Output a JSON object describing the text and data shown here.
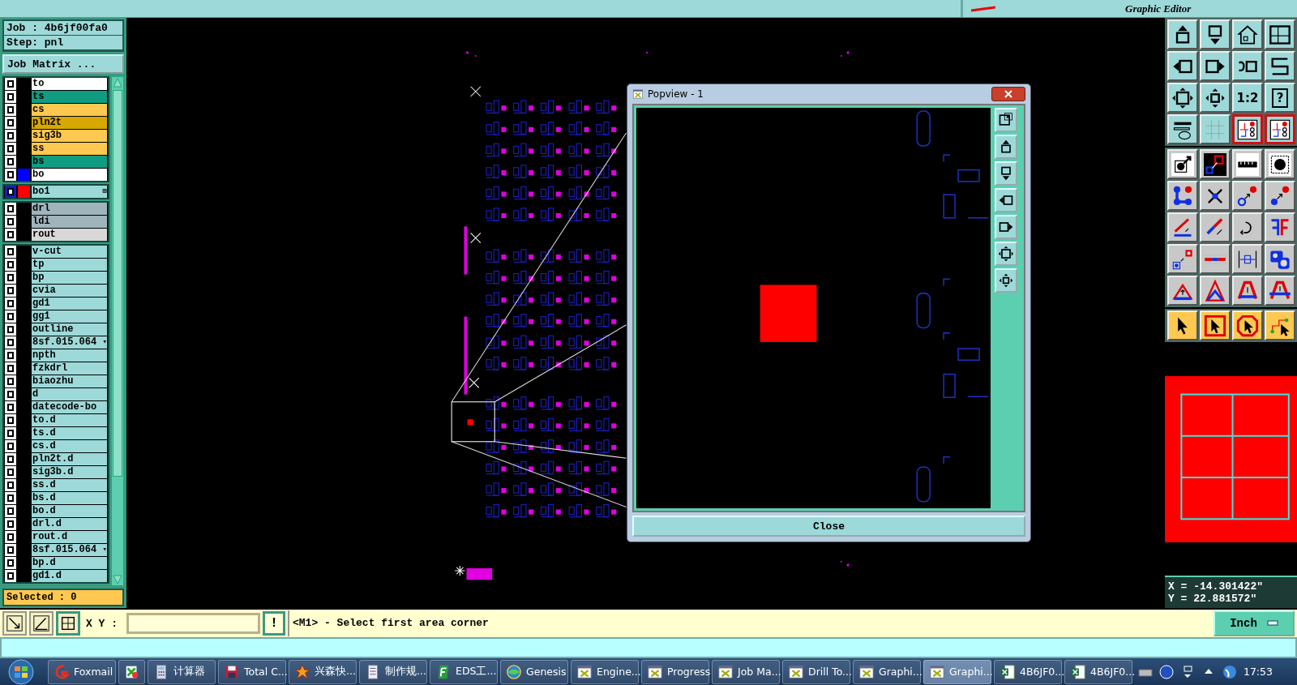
{
  "top_bar": {
    "subtitle": "Graphic Editor"
  },
  "job": {
    "job": "Job : 4b6jf00fa0",
    "step": "Step: pnl",
    "matrix_button": "Job Matrix ..."
  },
  "layer_groups": [
    {
      "kind": "board",
      "layers": [
        {
          "name": "to",
          "color": "#ffffff",
          "checked": true
        },
        {
          "name": "ts",
          "color": "#109c80",
          "checked": true
        },
        {
          "name": "cs",
          "color": "#ffc850",
          "checked": true
        },
        {
          "name": "pln2t",
          "color": "#d8a800",
          "checked": true
        },
        {
          "name": "sig3b",
          "color": "#ffc850",
          "checked": true
        },
        {
          "name": "ss",
          "color": "#ffc850",
          "checked": true
        },
        {
          "name": "bs",
          "color": "#109c80",
          "checked": true
        },
        {
          "name": "bo",
          "color": "#ffffff",
          "swatch": {
            "color": "#0000ff"
          },
          "checked": true
        }
      ]
    },
    {
      "kind": "work",
      "layers": [
        {
          "name": "bo1",
          "color": "#9ed9d9",
          "swatch": {
            "color": "#ff0000"
          },
          "marker": "⊞",
          "checked": true
        }
      ]
    },
    {
      "kind": "drill",
      "layers": [
        {
          "name": "drl",
          "color": "#a0b4bc",
          "checked": true
        },
        {
          "name": "ldi",
          "color": "#a0b4bc",
          "checked": true
        },
        {
          "name": "rout",
          "color": "#d8d8d8",
          "checked": true
        }
      ]
    },
    {
      "kind": "misc",
      "layers": [
        {
          "name": "v-cut",
          "color": "#9ed9d9",
          "checked": true
        },
        {
          "name": "tp",
          "color": "#9ed9d9",
          "checked": true
        },
        {
          "name": "bp",
          "color": "#9ed9d9",
          "checked": true
        },
        {
          "name": "cvia",
          "color": "#9ed9d9",
          "checked": true
        },
        {
          "name": "gd1",
          "color": "#9ed9d9",
          "checked": true
        },
        {
          "name": "gg1",
          "color": "#9ed9d9",
          "checked": true
        },
        {
          "name": "outline",
          "color": "#9ed9d9",
          "checked": true
        },
        {
          "name": "8sf.015.064",
          "color": "#9ed9d9",
          "marker": "▾",
          "checked": true
        },
        {
          "name": "npth",
          "color": "#9ed9d9",
          "checked": true
        },
        {
          "name": "fzkdrl",
          "color": "#9ed9d9",
          "checked": true
        },
        {
          "name": "biaozhu",
          "color": "#9ed9d9",
          "checked": true
        },
        {
          "name": "d",
          "color": "#9ed9d9",
          "checked": true
        },
        {
          "name": "datecode-bo",
          "color": "#9ed9d9",
          "checked": true
        },
        {
          "name": "to.d",
          "color": "#9ed9d9",
          "checked": true
        },
        {
          "name": "ts.d",
          "color": "#9ed9d9",
          "checked": true
        },
        {
          "name": "cs.d",
          "color": "#9ed9d9",
          "checked": true
        },
        {
          "name": "pln2t.d",
          "color": "#9ed9d9",
          "checked": true
        },
        {
          "name": "sig3b.d",
          "color": "#9ed9d9",
          "checked": true
        },
        {
          "name": "ss.d",
          "color": "#9ed9d9",
          "checked": true
        },
        {
          "name": "bs.d",
          "color": "#9ed9d9",
          "checked": true
        },
        {
          "name": "bo.d",
          "color": "#9ed9d9",
          "checked": true
        },
        {
          "name": "drl.d",
          "color": "#9ed9d9",
          "checked": true
        },
        {
          "name": "rout.d",
          "color": "#9ed9d9",
          "checked": true
        },
        {
          "name": "8sf.015.064",
          "color": "#9ed9d9",
          "marker": "▾",
          "checked": true
        },
        {
          "name": "bp.d",
          "color": "#9ed9d9",
          "checked": true
        },
        {
          "name": "gd1.d",
          "color": "#9ed9d9",
          "checked": true
        }
      ]
    }
  ],
  "selected_count": "Selected : 0",
  "tool_groups": [
    {
      "kind": "view",
      "tools": [
        {
          "kind": "box-up",
          "active": false
        },
        {
          "kind": "box-down",
          "active": false
        },
        {
          "kind": "house",
          "active": false
        },
        {
          "kind": "grid-window",
          "active": false
        },
        {
          "kind": "box-left",
          "active": false
        },
        {
          "kind": "box-right",
          "active": false
        },
        {
          "kind": "undo-box",
          "active": false
        },
        {
          "kind": "s-path",
          "active": false
        },
        {
          "kind": "expand",
          "active": false
        },
        {
          "kind": "shrink",
          "active": false
        },
        {
          "kind": "ratio",
          "label": "1:2",
          "active": false
        },
        {
          "kind": "help",
          "label": "?",
          "active": false
        },
        {
          "kind": "tools",
          "active": false
        },
        {
          "kind": "grid",
          "active": false
        },
        {
          "kind": "circuit",
          "active": true
        },
        {
          "kind": "circuit",
          "active": true
        }
      ]
    },
    {
      "kind": "edit",
      "tools": [
        {
          "kind": "dot-arrow",
          "active": false
        },
        {
          "kind": "square-link",
          "active": false
        },
        {
          "kind": "ruler",
          "active": false
        },
        {
          "kind": "dot-frame",
          "active": false
        },
        {
          "kind": "nodes",
          "active": false
        },
        {
          "kind": "cross",
          "active": false
        },
        {
          "kind": "ring-arrow",
          "active": false
        },
        {
          "kind": "dot-arrow-blue",
          "active": false
        },
        {
          "kind": "angle-red",
          "active": false
        },
        {
          "kind": "line-arrow",
          "active": false
        },
        {
          "kind": "rotate",
          "active": false
        },
        {
          "kind": "mirror",
          "active": false
        },
        {
          "kind": "square-move",
          "active": false
        },
        {
          "kind": "line-split",
          "active": false
        },
        {
          "kind": "width",
          "active": false
        },
        {
          "kind": "blobs",
          "active": false
        },
        {
          "kind": "tri-small",
          "active": false
        },
        {
          "kind": "tri-double",
          "active": false
        },
        {
          "kind": "tri-arch",
          "active": false
        },
        {
          "kind": "tri-cross",
          "active": false
        }
      ]
    },
    {
      "kind": "select",
      "tools": [
        {
          "kind": "cursor",
          "active": false
        },
        {
          "kind": "cursor-frame",
          "active": false
        },
        {
          "kind": "cursor-oct",
          "active": false
        },
        {
          "kind": "cursor-route",
          "active": false
        }
      ]
    }
  ],
  "coordinates": {
    "x": "X = -14.301422\"",
    "y": "Y = 22.881572\""
  },
  "popview": {
    "title": "Popview - 1",
    "tools": [
      {
        "kind": "zoom-fit"
      },
      {
        "kind": "box-up"
      },
      {
        "kind": "box-down"
      },
      {
        "kind": "box-left"
      },
      {
        "kind": "box-right"
      },
      {
        "kind": "expand"
      },
      {
        "kind": "shrink"
      }
    ],
    "close_button": "Close"
  },
  "command_bar": {
    "tools": [
      {
        "kind": "diagonal",
        "active": false
      },
      {
        "kind": "angle",
        "active": false
      },
      {
        "kind": "grid-snap",
        "active": true
      }
    ],
    "xy_label": "X Y :",
    "alert_button": "!",
    "message": "<M1> - Select first area corner",
    "units_button": "Inch"
  },
  "taskbar": {
    "items": [
      {
        "kind": "fox",
        "label": "Foxmail",
        "selected": false
      },
      {
        "kind": "flag",
        "selected": false
      },
      {
        "kind": "calc",
        "label": "计算器",
        "selected": false
      },
      {
        "kind": "disk",
        "label": "Total C...",
        "selected": false
      },
      {
        "kind": "star",
        "label": "兴森快...",
        "selected": false
      },
      {
        "kind": "doc",
        "label": "制作规...",
        "selected": false
      },
      {
        "kind": "eds",
        "label": "EDS工...",
        "selected": false
      },
      {
        "kind": "globe",
        "label": "Genesis",
        "selected": false
      },
      {
        "kind": "xapp",
        "label": "Engine...",
        "selected": false
      },
      {
        "kind": "xapp",
        "label": "Progress",
        "selected": false
      },
      {
        "kind": "xapp",
        "label": "Job Ma...",
        "selected": false
      },
      {
        "kind": "xapp",
        "label": "Drill To...",
        "selected": false
      },
      {
        "kind": "xapp",
        "label": "Graphi...",
        "selected": false
      },
      {
        "kind": "xapp",
        "label": "Graphi...",
        "selected": true
      },
      {
        "kind": "excel",
        "label": "4B6JF0...",
        "selected": false
      },
      {
        "kind": "excel",
        "label": "4B6JF0...",
        "selected": false
      }
    ],
    "clock": "17:53"
  }
}
